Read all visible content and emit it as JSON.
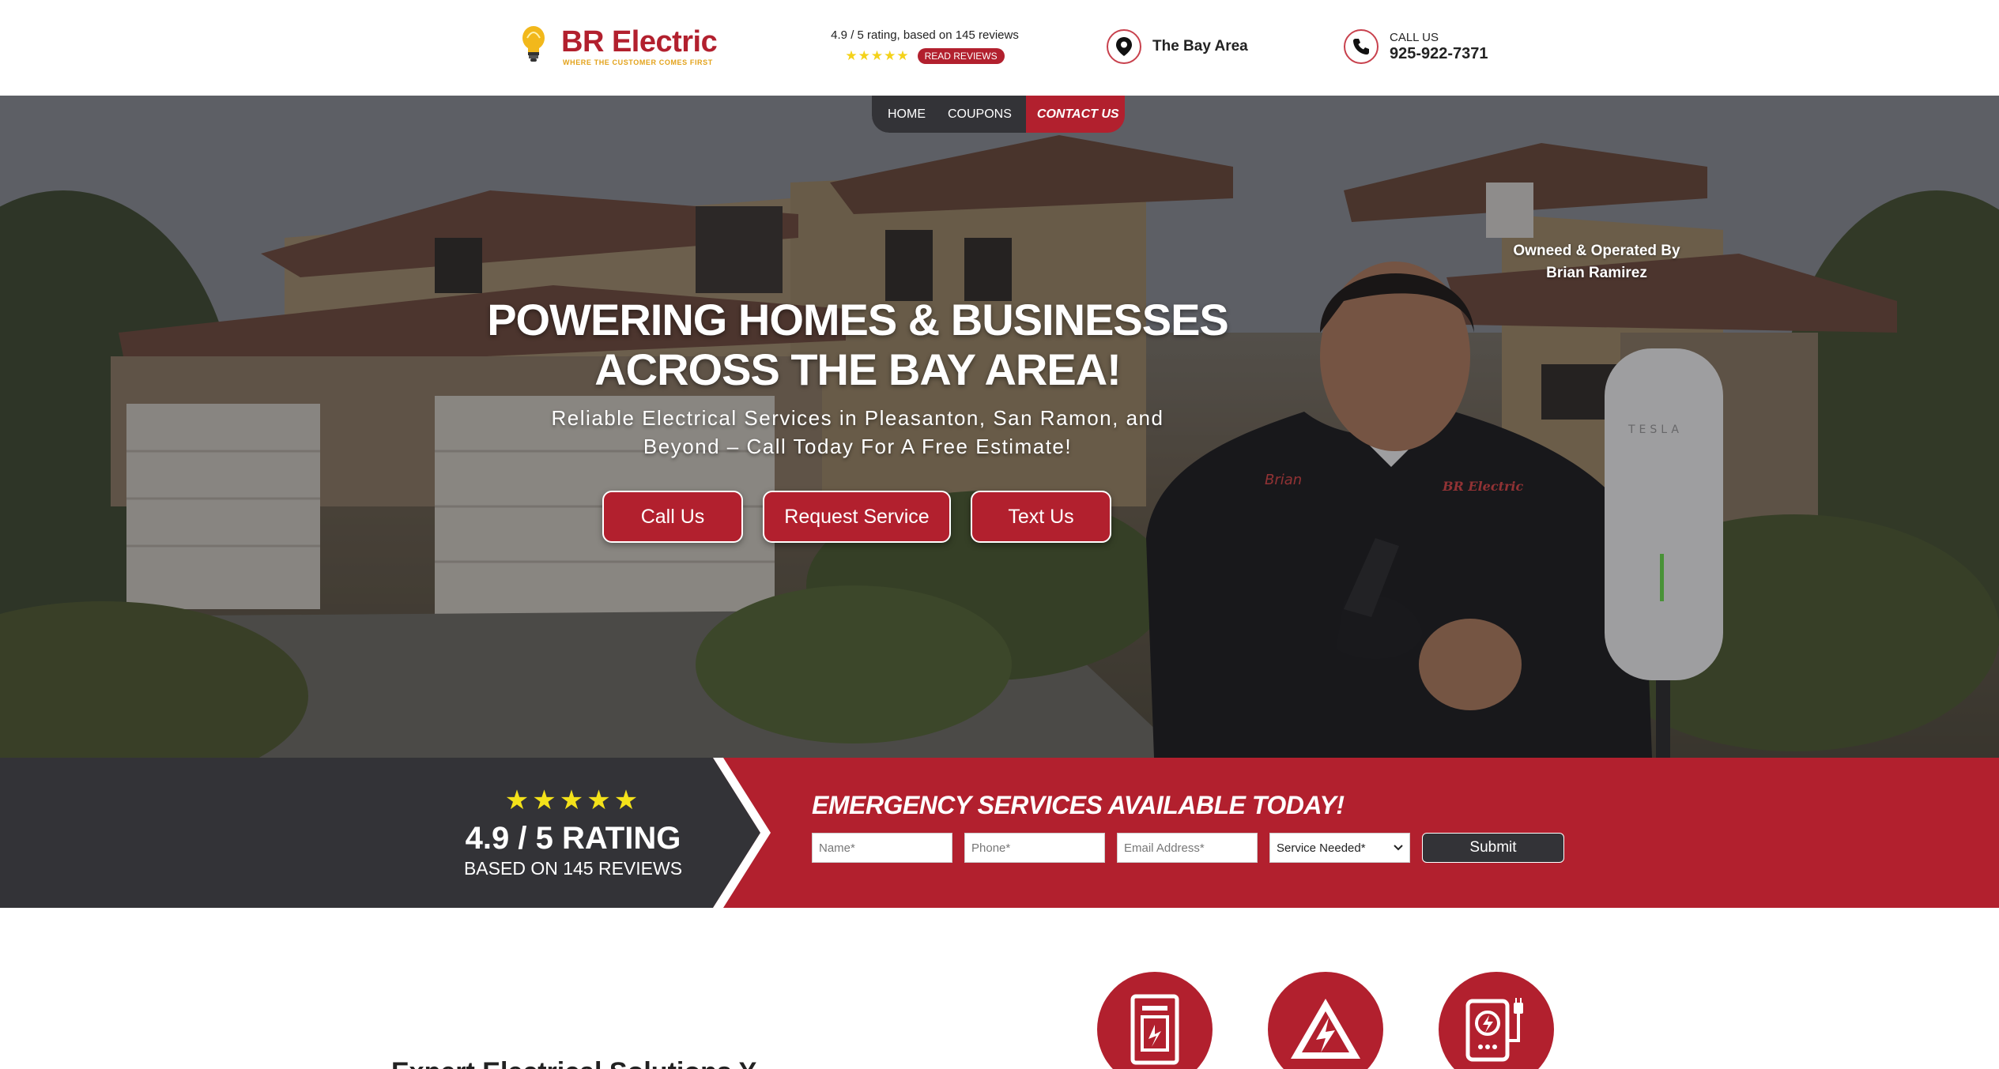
{
  "header": {
    "brand": "BR Electric",
    "tagline": "WHERE THE CUSTOMER COMES FIRST",
    "rating_text": "4.9 / 5 rating, based on 145 reviews",
    "stars": "★★★★★",
    "read_reviews": "READ REVIEWS",
    "location": "The Bay Area",
    "call_label": "CALL US",
    "phone": "925-922-7371"
  },
  "nav": {
    "items": [
      "HOME",
      "COUPONS"
    ],
    "contact": "CONTACT US"
  },
  "hero": {
    "title_line1": "POWERING HOMES & BUSINESSES",
    "title_line2": "ACROSS THE BAY AREA!",
    "subtitle_line1": "Reliable Electrical Services in Pleasanton, San Ramon, and",
    "subtitle_line2": "Beyond – Call Today For A Free Estimate!",
    "buttons": [
      "Call Us",
      "Request Service",
      "Text Us"
    ],
    "owner_line1": "Owneed & Operated By",
    "owner_line2": "Brian Ramirez",
    "shirt_name": "Brian",
    "shirt_logo": "BR Electric",
    "charger_brand": "TESLA"
  },
  "band": {
    "stars": "★★★★★",
    "rating": "4.9 / 5 RATING",
    "reviews": "BASED ON 145 REVIEWS",
    "form_title": "EMERGENCY SERVICES AVAILABLE TODAY!",
    "name_placeholder": "Name*",
    "phone_placeholder": "Phone*",
    "email_placeholder": "Email Address*",
    "service_selected": "Service Needed*",
    "submit": "Submit"
  },
  "below": {
    "title": "Expert Electrical Solutions Y..."
  },
  "colors": {
    "brand_red": "#b2202e",
    "dark": "#333337",
    "star_yellow": "#f4e21a",
    "tagline_gold": "#e3a21a"
  },
  "icons": [
    "bulb-icon",
    "map-pin-icon",
    "phone-icon",
    "electrical-panel-icon",
    "high-voltage-icon",
    "ev-charger-icon"
  ]
}
